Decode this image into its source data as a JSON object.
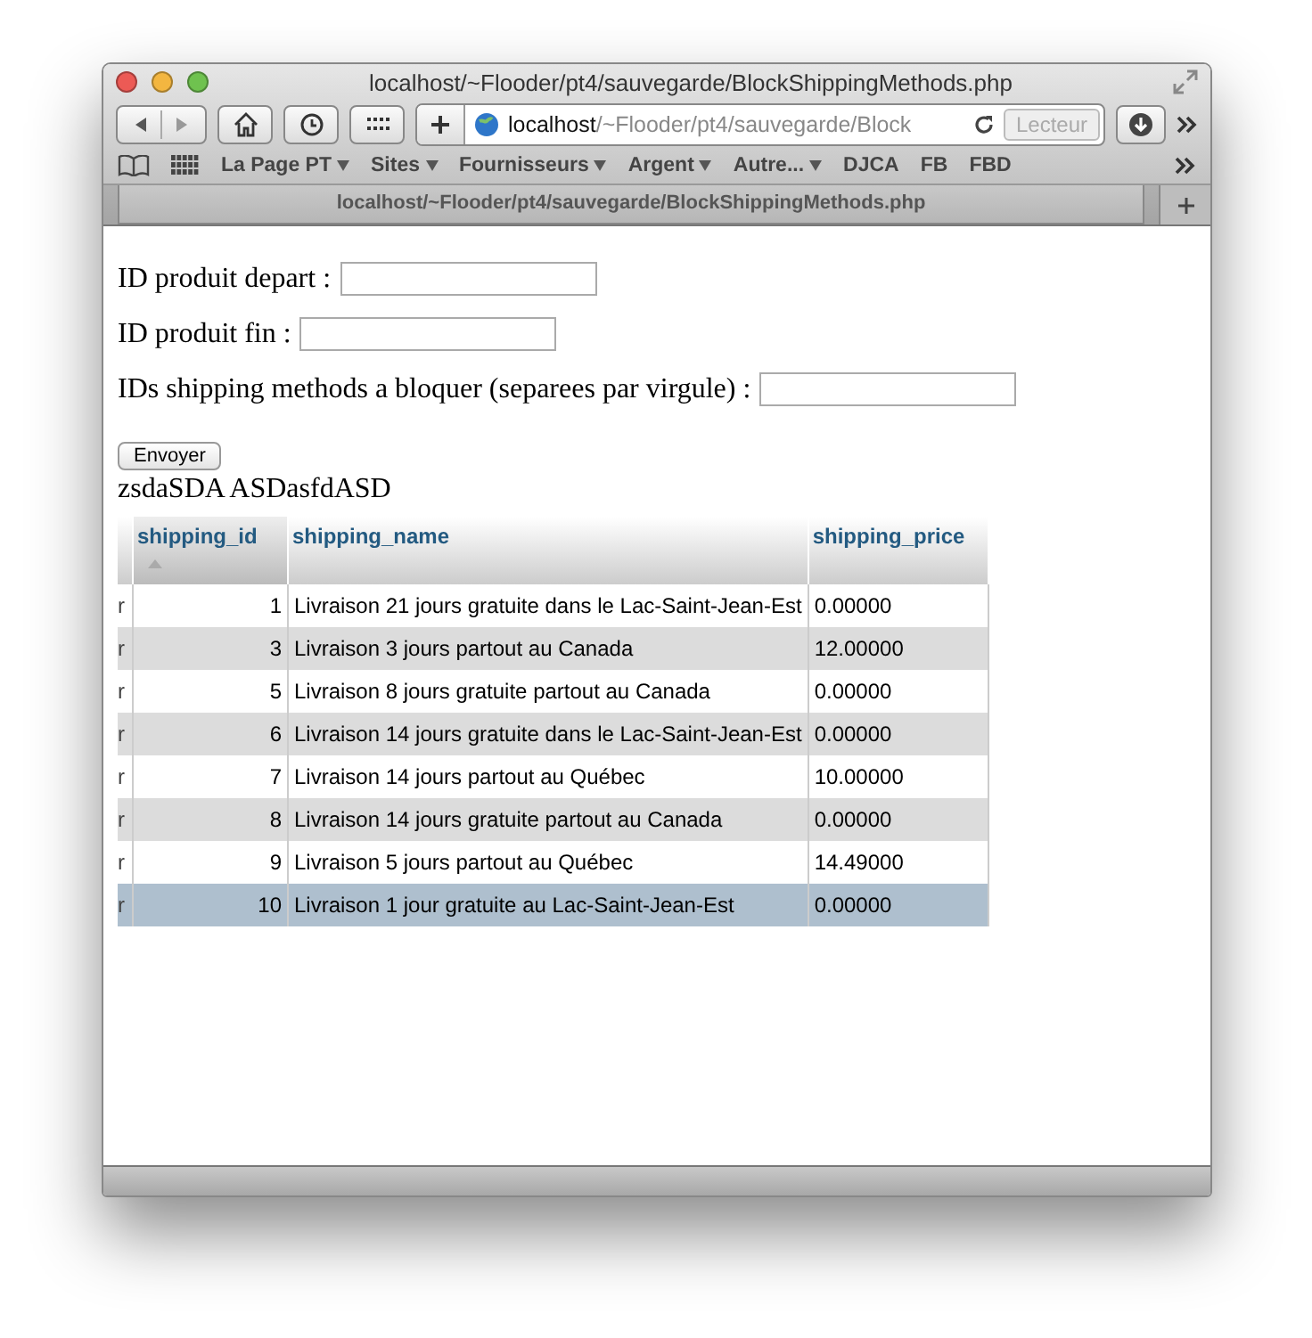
{
  "window": {
    "title": "localhost/~Flooder/pt4/sauvegarde/BlockShippingMethods.php"
  },
  "toolbar": {
    "address_host": "localhost",
    "address_path": "/~Flooder/pt4/sauvegarde/Block",
    "reader_button": "Lecteur"
  },
  "bookmarks": [
    {
      "label": "La Page PT",
      "dropdown": true
    },
    {
      "label": "Sites",
      "dropdown": true
    },
    {
      "label": "Fournisseurs",
      "dropdown": true
    },
    {
      "label": "Argent",
      "dropdown": true
    },
    {
      "label": "Autre...",
      "dropdown": true
    },
    {
      "label": "DJCA",
      "dropdown": false
    },
    {
      "label": "FB",
      "dropdown": false
    },
    {
      "label": "FBD",
      "dropdown": false
    }
  ],
  "tab": {
    "title": "localhost/~Flooder/pt4/sauvegarde/BlockShippingMethods.php"
  },
  "form": {
    "fields": [
      {
        "label": "ID produit depart :"
      },
      {
        "label": "ID produit fin :"
      },
      {
        "label": "IDs shipping methods a bloquer (separees par virgule) :"
      }
    ],
    "submit": "Envoyer"
  },
  "output_text": "zsdaSDA ASDasfdASD",
  "table": {
    "columns": [
      "shipping_id",
      "shipping_name",
      "shipping_price"
    ],
    "rows": [
      {
        "column_0": "r",
        "shipping_id": "1",
        "shipping_name": "Livraison 21 jours gratuite dans le Lac-Saint-Jean-Est",
        "shipping_price": "0.00000",
        "selected": false
      },
      {
        "column_0": "r",
        "shipping_id": "3",
        "shipping_name": "Livraison 3 jours partout au Canada",
        "shipping_price": "12.00000",
        "selected": false
      },
      {
        "column_0": "r",
        "shipping_id": "5",
        "shipping_name": "Livraison 8 jours gratuite partout au Canada",
        "shipping_price": "0.00000",
        "selected": false
      },
      {
        "column_0": "r",
        "shipping_id": "6",
        "shipping_name": "Livraison 14 jours gratuite dans le Lac-Saint-Jean-Est",
        "shipping_price": "0.00000",
        "selected": false
      },
      {
        "column_0": "r",
        "shipping_id": "7",
        "shipping_name": "Livraison 14 jours partout au Québec",
        "shipping_price": "10.00000",
        "selected": false
      },
      {
        "column_0": "r",
        "shipping_id": "8",
        "shipping_name": "Livraison 14 jours gratuite partout au Canada",
        "shipping_price": "0.00000",
        "selected": false
      },
      {
        "column_0": "r",
        "shipping_id": "9",
        "shipping_name": "Livraison 5 jours partout au Québec",
        "shipping_price": "14.49000",
        "selected": false
      },
      {
        "column_0": "r",
        "shipping_id": "10",
        "shipping_name": "Livraison 1 jour gratuite au Lac-Saint-Jean-Est",
        "shipping_price": "0.00000",
        "selected": true
      }
    ]
  }
}
